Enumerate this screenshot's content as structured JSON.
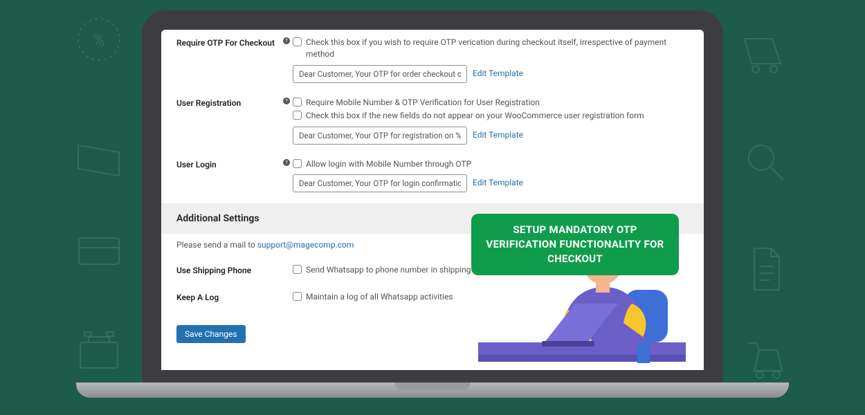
{
  "rows": {
    "checkout": {
      "label": "Require OTP For Checkout",
      "desc": "Check this box if you wish to require OTP verication during checkout itself, irrespective of payment method",
      "tpl": "Dear Customer, Your OTP for order checkout on %shop",
      "edit": "Edit Template"
    },
    "register": {
      "label": "User Registration",
      "desc1": "Require Mobile Number & OTP Verification for User Registration",
      "desc2": "Check this box if the new fields do not appear on your WooCommerce user registration form",
      "tpl": "Dear Customer, Your OTP for registration on %shop_n",
      "edit": "Edit Template"
    },
    "login": {
      "label": "User Login",
      "desc": "Allow login with Mobile Number through OTP",
      "tpl": "Dear Customer, Your OTP for login confirmation on %",
      "edit": "Edit Template"
    },
    "shipping": {
      "label": "Use Shipping Phone",
      "desc": "Send Whatsapp to phone number in shipping address"
    },
    "log": {
      "label": "Keep A Log",
      "desc": "Maintain a log of all Whatsapp activities"
    }
  },
  "section_additional": "Additional Settings",
  "note_prefix": "Please send a mail to ",
  "note_link": "support@magecomp.com",
  "save_label": "Save Changes",
  "badge": "SETUP MANDATORY OTP VERIFICATION FUNCTIONALITY FOR CHECKOUT"
}
